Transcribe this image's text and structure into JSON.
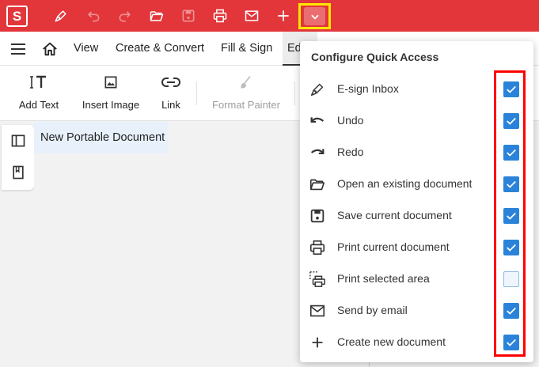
{
  "app": {
    "logo_letter": "S"
  },
  "quick_access_toolbar": {
    "items": [
      {
        "icon": "pen-icon"
      },
      {
        "icon": "undo-icon"
      },
      {
        "icon": "redo-icon"
      },
      {
        "icon": "folder-open-icon"
      },
      {
        "icon": "save-icon"
      },
      {
        "icon": "print-icon"
      },
      {
        "icon": "mail-icon"
      },
      {
        "icon": "plus-icon"
      }
    ],
    "dropdown_icon": "chevron-down-icon"
  },
  "menu": {
    "items": [
      "View",
      "Create & Convert",
      "Fill & Sign",
      "Ed"
    ],
    "active_index": 3
  },
  "ribbon": {
    "add_text": "Add Text",
    "insert_image": "Insert Image",
    "link": "Link",
    "format_painter": "Format Painter"
  },
  "document": {
    "tab_title": "New Portable Document"
  },
  "popup": {
    "title": "Configure Quick Access",
    "items": [
      {
        "label": "E-sign Inbox",
        "icon": "pen-icon",
        "checked": true
      },
      {
        "label": "Undo",
        "icon": "undo-icon",
        "checked": true
      },
      {
        "label": "Redo",
        "icon": "redo-icon",
        "checked": true
      },
      {
        "label": "Open an existing document",
        "icon": "folder-open-icon",
        "checked": true
      },
      {
        "label": "Save current document",
        "icon": "save-icon",
        "checked": true
      },
      {
        "label": "Print current document",
        "icon": "print-icon",
        "checked": true
      },
      {
        "label": "Print selected area",
        "icon": "print-area-icon",
        "checked": false
      },
      {
        "label": "Send by email",
        "icon": "mail-icon",
        "checked": true
      },
      {
        "label": "Create new document",
        "icon": "plus-icon",
        "checked": true
      }
    ]
  },
  "colors": {
    "titlebar": "#e2363b",
    "checkbox_checked": "#2a83d9",
    "highlight_red": "#ff0000",
    "highlight_yellow": "#ffe600"
  }
}
